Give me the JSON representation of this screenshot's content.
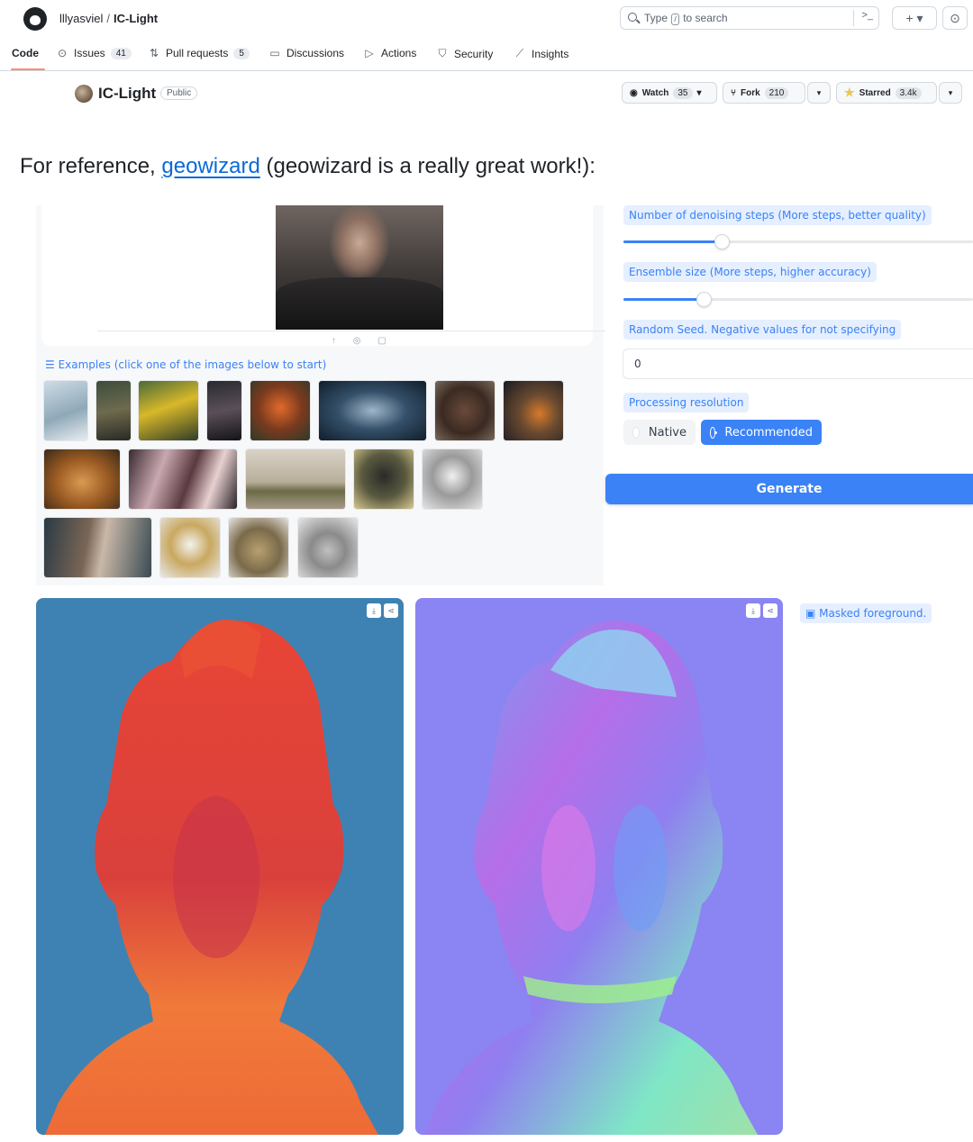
{
  "header": {
    "owner": "lllyasviel",
    "separator": "/",
    "repo": "IC-Light",
    "search_text_before": "Type",
    "search_key": "/",
    "search_text_after": "to search",
    "terminal_icon": ">_",
    "plus_icon": "+ ▾",
    "issues_icon": "⊙"
  },
  "nav": {
    "tabs": [
      {
        "label": "Code",
        "icon": "",
        "count": null,
        "active": true
      },
      {
        "label": "Issues",
        "icon": "⊙",
        "count": "41"
      },
      {
        "label": "Pull requests",
        "icon": "⇅",
        "count": "5"
      },
      {
        "label": "Discussions",
        "icon": "▭",
        "count": null
      },
      {
        "label": "Actions",
        "icon": "▷",
        "count": null
      },
      {
        "label": "Security",
        "icon": "⛉",
        "count": null
      },
      {
        "label": "Insights",
        "icon": "⟋",
        "count": null
      }
    ]
  },
  "repo": {
    "name": "IC-Light",
    "visibility": "Public",
    "watch_label": "Watch",
    "watch_count": "35",
    "fork_label": "Fork",
    "fork_count": "210",
    "star_label": "Starred",
    "star_count": "3.4k"
  },
  "readme": {
    "prefix": "For reference, ",
    "link_text": "geowizard",
    "suffix": " (geowizard is a really great work!):"
  },
  "demo": {
    "examples_label": "☰ Examples (click one of the images below to start)",
    "input_tools": "↑ ◎ ▢",
    "steps_label": "Number of denoising steps (More steps, better quality)",
    "steps_fraction": 0.28,
    "ensemble_label": "Ensemble size (More steps, higher accuracy)",
    "ensemble_fraction": 0.23,
    "seed_label": "Random Seed. Negative values for not specifying",
    "seed_value": "0",
    "resolution_label": "Processing resolution",
    "resolution_options": [
      "Native",
      "Recommended"
    ],
    "resolution_selected": "Recommended",
    "generate_label": "Generate",
    "masked_label": "Masked foreground.",
    "masked_icon": "▣"
  },
  "colors": {
    "accent": "#3b82f6",
    "link": "#0969da",
    "depth_bg": "#3e82b3",
    "depth_figure": "#e84f35",
    "normal_bg": "#8a85f2"
  }
}
